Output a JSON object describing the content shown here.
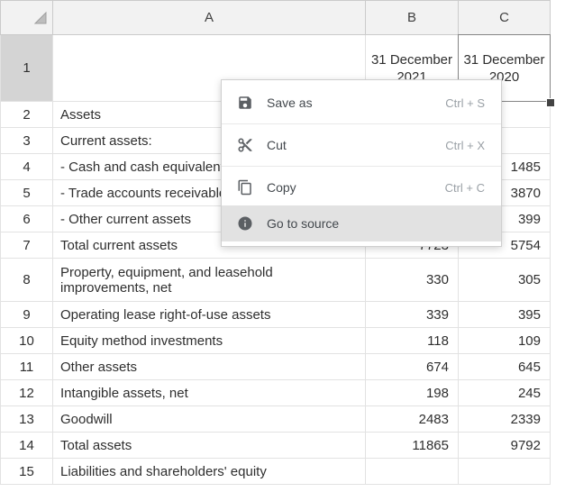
{
  "sheet": {
    "columns": [
      {
        "label": "A"
      },
      {
        "label": "B"
      },
      {
        "label": "C"
      }
    ],
    "rows": [
      {
        "num": "1",
        "a": "",
        "b": "31 December 2021",
        "c": "31 December 2020"
      },
      {
        "num": "2",
        "a": "Assets",
        "b": "",
        "c": ""
      },
      {
        "num": "3",
        "a": "Current assets:",
        "b": "",
        "c": ""
      },
      {
        "num": "4",
        "a": "- Cash and cash equivalents",
        "b": "",
        "c": "1485"
      },
      {
        "num": "5",
        "a": "- Trade accounts receivable",
        "b": "",
        "c": "3870"
      },
      {
        "num": "6",
        "a": "- Other current assets",
        "b": "",
        "c": "399"
      },
      {
        "num": "7",
        "a": "Total current assets",
        "b": "7723",
        "c": "5754"
      },
      {
        "num": "8",
        "a": "Property, equipment, and leasehold improvements, net",
        "b": "330",
        "c": "305"
      },
      {
        "num": "9",
        "a": "Operating lease right-of-use assets",
        "b": "339",
        "c": "395"
      },
      {
        "num": "10",
        "a": "Equity method investments",
        "b": "118",
        "c": "109"
      },
      {
        "num": "11",
        "a": "Other assets",
        "b": "674",
        "c": "645"
      },
      {
        "num": "12",
        "a": "Intangible assets, net",
        "b": "198",
        "c": "245"
      },
      {
        "num": "13",
        "a": "Goodwill",
        "b": "2483",
        "c": "2339"
      },
      {
        "num": "14",
        "a": "Total assets",
        "b": "11865",
        "c": "9792"
      },
      {
        "num": "15",
        "a": "Liabilities and shareholders' equity",
        "b": "",
        "c": ""
      }
    ]
  },
  "context_menu": {
    "items": [
      {
        "label": "Save as",
        "shortcut": "Ctrl + S",
        "icon": "save-icon"
      },
      {
        "label": "Cut",
        "shortcut": "Ctrl + X",
        "icon": "scissors-icon"
      },
      {
        "label": "Copy",
        "shortcut": "Ctrl + C",
        "icon": "copy-icon"
      },
      {
        "label": "Go to source",
        "shortcut": "",
        "icon": "info-icon",
        "highlighted": true
      }
    ]
  },
  "colors": {
    "header_highlight": "#d4d4d4",
    "selection_fill": "#e0e0e0",
    "menu_highlight": "#e2e2e2"
  }
}
